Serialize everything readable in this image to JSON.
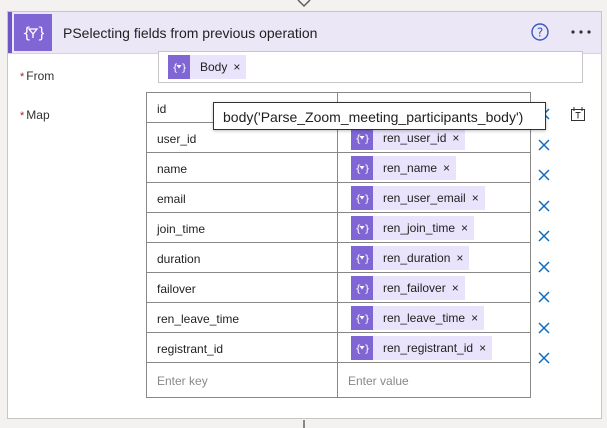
{
  "action": {
    "title": "PSelecting fields from previous operation",
    "icon": "data-operation-icon",
    "accent_color": "#8066d5",
    "header_bg": "#ebe7f6"
  },
  "header_buttons": [
    {
      "name": "help-icon",
      "icon": "question-circle"
    },
    {
      "name": "more-options-icon",
      "icon": "ellipsis"
    }
  ],
  "from": {
    "label": "From",
    "required_mark": "*",
    "token": {
      "label": "Body",
      "remove": "×"
    }
  },
  "map": {
    "label": "Map",
    "required_mark": "*",
    "rows": [
      {
        "key": "id",
        "value": "",
        "remove": "×"
      },
      {
        "key": "user_id",
        "value": "ren_user_id",
        "remove": "×"
      },
      {
        "key": "name",
        "value": "ren_name",
        "remove": "×"
      },
      {
        "key": "email",
        "value": "ren_user_email",
        "remove": "×"
      },
      {
        "key": "join_time",
        "value": "ren_join_time",
        "remove": "×"
      },
      {
        "key": "duration",
        "value": "ren_duration",
        "remove": "×"
      },
      {
        "key": "failover",
        "value": "ren_failover",
        "remove": "×"
      },
      {
        "key": "ren_leave_time",
        "value": "ren_leave_time",
        "remove": "×"
      },
      {
        "key": "registrant_id",
        "value": "ren_registrant_id",
        "remove": "×"
      }
    ],
    "new_row": {
      "key_placeholder": "Enter key",
      "value_placeholder": "Enter value"
    }
  },
  "tooltip": {
    "text": "body('Parse_Zoom_meeting_participants_body')"
  },
  "switch_mode_icon": "switch-to-text-mode-icon"
}
